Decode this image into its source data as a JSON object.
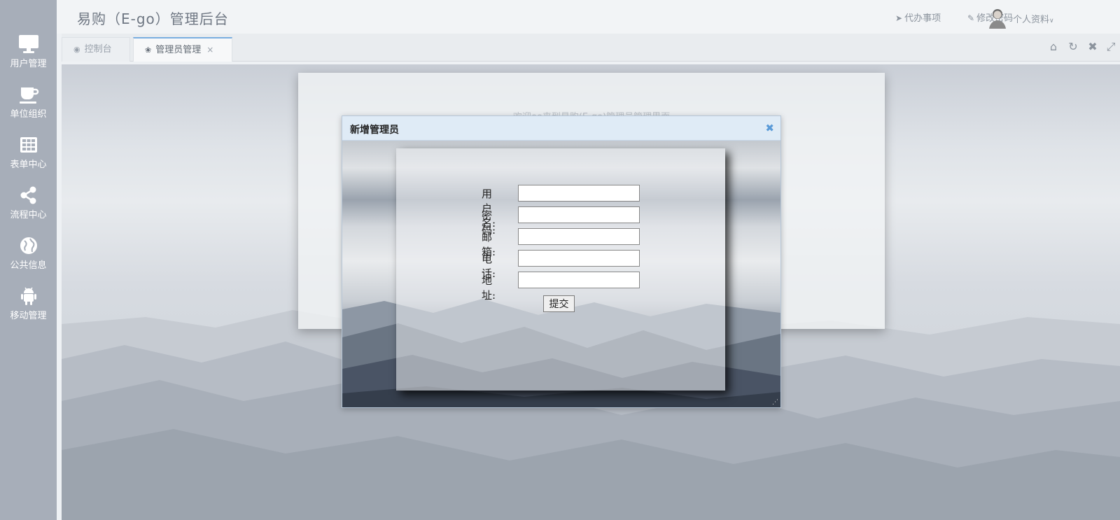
{
  "header": {
    "app_title": "易购（E-go）管理后台",
    "todo_label": "代办事项",
    "change_password_label": "修改密码",
    "profile_label": "个人资料"
  },
  "sidebar": {
    "items": [
      {
        "label": "用户管理",
        "icon": "monitor-icon"
      },
      {
        "label": "单位组织",
        "icon": "coffee-icon"
      },
      {
        "label": "表单中心",
        "icon": "table-icon"
      },
      {
        "label": "流程中心",
        "icon": "share-icon"
      },
      {
        "label": "公共信息",
        "icon": "globe-icon"
      },
      {
        "label": "移动管理",
        "icon": "android-icon"
      }
    ]
  },
  "tabs": [
    {
      "label": "控制台",
      "icon": "dashboard-icon",
      "active": false
    },
    {
      "label": "管理员管理",
      "icon": "leaf-icon",
      "active": true,
      "close": "×"
    }
  ],
  "tab_tools": [
    "home-icon",
    "refresh-icon",
    "close-icon",
    "fullscreen-icon"
  ],
  "welcome": {
    "text": "欢迎ee来到易购(E-go)管理员管理界面"
  },
  "dialog": {
    "title": "新增管理员",
    "close": "✖",
    "fields": [
      {
        "label": "用户名:",
        "value": ""
      },
      {
        "label": "密码:",
        "value": ""
      },
      {
        "label": "邮箱:",
        "value": ""
      },
      {
        "label": "电话:",
        "value": ""
      },
      {
        "label": "地址:",
        "value": ""
      }
    ],
    "submit_label": "提交"
  }
}
